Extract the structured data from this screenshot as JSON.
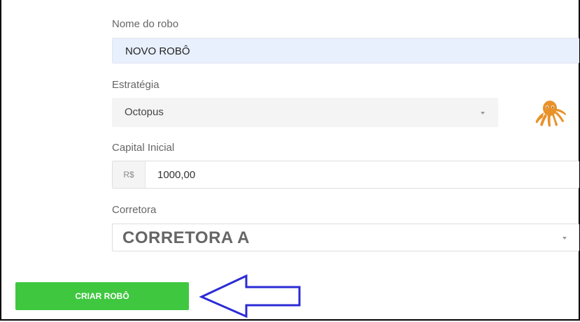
{
  "form": {
    "robot_name": {
      "label": "Nome do robo",
      "value": "NOVO ROBÔ"
    },
    "strategy": {
      "label": "Estratégia",
      "value": "Octopus",
      "icon": "octopus-icon"
    },
    "capital": {
      "label": "Capital Inicial",
      "currency": "R$",
      "value": "1000,00"
    },
    "broker": {
      "label": "Corretora",
      "value": "CORRETORA A"
    }
  },
  "actions": {
    "create_label": "CRIAR ROBÔ"
  },
  "colors": {
    "primary_button": "#3fc73f",
    "autofill_background": "#e8f0fe",
    "annotation_arrow": "#2b2bd6",
    "octopus": "#e8922a"
  }
}
